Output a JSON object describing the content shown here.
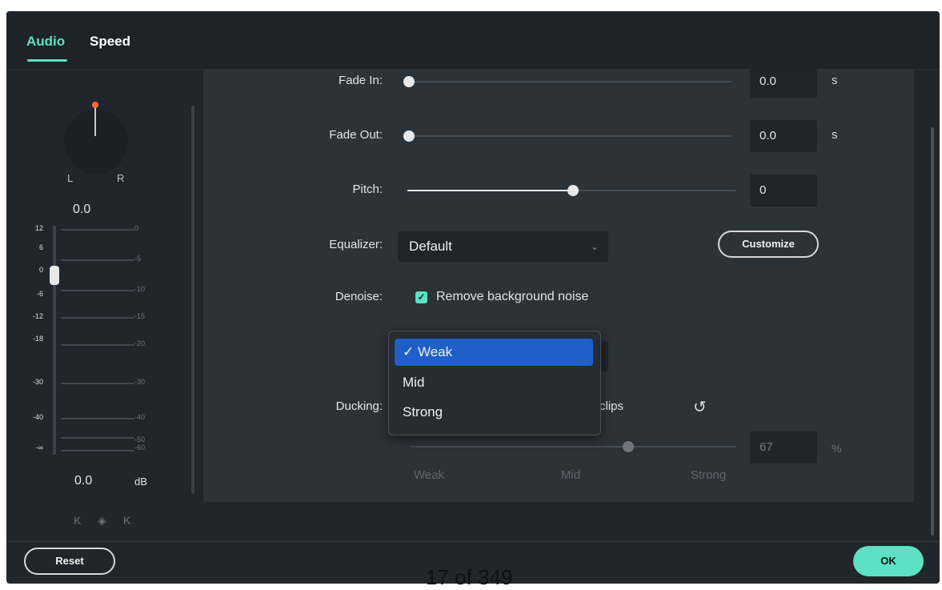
{
  "tabs": [
    {
      "label": "Audio",
      "active": true
    },
    {
      "label": "Speed",
      "active": false
    }
  ],
  "pan": {
    "left_label": "L",
    "right_label": "R",
    "value": "0.0"
  },
  "meter": {
    "left_scale": [
      "12",
      "6",
      "0",
      "-6",
      "-12",
      "-18",
      "-30",
      "-40",
      "-∞"
    ],
    "right_scale": [
      "0",
      "-5",
      "-10",
      "-15",
      "-20",
      "-30",
      "-40",
      "-50",
      "-60"
    ],
    "gain_value": "0.0",
    "gain_unit": "dB",
    "keyframe_icons": [
      "K",
      "◈",
      "K"
    ]
  },
  "fields": {
    "fade_in": {
      "label": "Fade In:",
      "value": "0.0",
      "unit": "s",
      "level": 0
    },
    "fade_out": {
      "label": "Fade Out:",
      "value": "0.0",
      "unit": "s",
      "level": 0
    },
    "pitch": {
      "label": "Pitch:",
      "value": "0",
      "level": 0.5
    },
    "equalizer": {
      "label": "Equalizer:",
      "value": "Default",
      "button": "Customize"
    },
    "denoise": {
      "label": "Denoise:",
      "checkbox_label": "Remove background noise",
      "checked": true
    },
    "ducking": {
      "label": "Ducking:",
      "partial_text": "clips",
      "value": "67",
      "unit": "%",
      "level": 0.67,
      "ticks": [
        "Weak",
        "Mid",
        "Strong"
      ]
    }
  },
  "dropdown": {
    "options": [
      {
        "label": "✓ Weak",
        "selected": true
      },
      {
        "label": "Mid",
        "selected": false
      },
      {
        "label": "Strong",
        "selected": false
      }
    ]
  },
  "footer": {
    "reset_label": "Reset",
    "ok_label": "OK"
  },
  "page_counter": "17 of 349",
  "colors": {
    "accent": "#5ee0c4",
    "selection": "#1e5fc9",
    "panel": "#2b3238",
    "background": "#20262b"
  },
  "icons": {
    "reset_icon": "↺",
    "chevron": "⌄",
    "check": "✓"
  }
}
